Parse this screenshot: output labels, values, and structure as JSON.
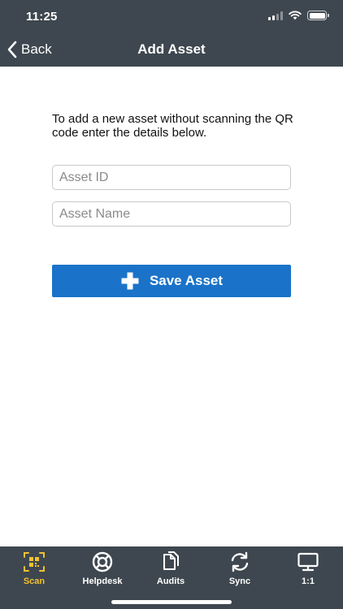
{
  "status_bar": {
    "time": "11:25"
  },
  "nav": {
    "back_label": "Back",
    "title": "Add Asset"
  },
  "form": {
    "instructions": "To add a new asset without scanning the QR code enter the details below.",
    "asset_id_placeholder": "Asset ID",
    "asset_id_value": "",
    "asset_name_placeholder": "Asset Name",
    "asset_name_value": "",
    "save_label": "Save Asset"
  },
  "tabs": [
    {
      "label": "Scan",
      "icon": "qr-scan-icon",
      "active": true
    },
    {
      "label": "Helpdesk",
      "icon": "lifebuoy-icon",
      "active": false
    },
    {
      "label": "Audits",
      "icon": "documents-icon",
      "active": false
    },
    {
      "label": "Sync",
      "icon": "sync-icon",
      "active": false
    },
    {
      "label": "1:1",
      "icon": "monitor-icon",
      "active": false
    }
  ],
  "colors": {
    "header_bg": "#3e474f",
    "accent_blue": "#1a73c9",
    "active_tab": "#f2c230"
  }
}
